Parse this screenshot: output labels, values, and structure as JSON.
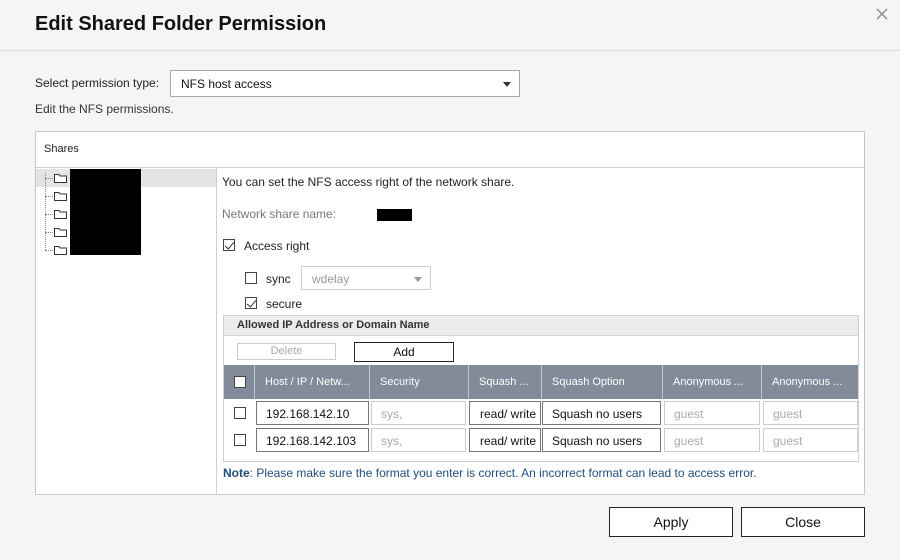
{
  "dialog": {
    "title": "Edit Shared Folder Permission",
    "close_icon": "close-icon"
  },
  "permission": {
    "label": "Select permission type:",
    "selected": "NFS host access",
    "description": "Edit the NFS permissions."
  },
  "shares": {
    "header": "Shares",
    "folder_icon": "folder-icon",
    "item_count": 5
  },
  "nfs": {
    "intro": "You can set the NFS access right of the network share.",
    "share_name_label": "Network share name:",
    "access_right_label": "Access right",
    "access_right_checked": true,
    "sync_label": "sync",
    "sync_checked": false,
    "sync_option": "wdelay",
    "secure_label": "secure",
    "secure_checked": true
  },
  "allowed": {
    "header": "Allowed IP Address or Domain Name",
    "delete_label": "Delete",
    "add_label": "Add",
    "columns": [
      "Host / IP / Netw...",
      "Security",
      "Squash ...",
      "Squash Option",
      "Anonymous ...",
      "Anonymous ..."
    ],
    "rows": [
      {
        "host": "192.168.142.10",
        "security": "sys,",
        "squash": "read/ write",
        "squash_option": "Squash no users",
        "anon_uid": "guest",
        "anon_gid": "guest"
      },
      {
        "host": "192.168.142.103",
        "security": "sys,",
        "squash": "read/ write",
        "squash_option": "Squash no users",
        "anon_uid": "guest",
        "anon_gid": "guest"
      }
    ],
    "note_prefix": "Note",
    "note_text": ": Please make sure the format you enter is correct. An incorrect format can lead to access error."
  },
  "buttons": {
    "apply": "Apply",
    "close": "Close"
  },
  "colors": {
    "grid_header": "#818b99",
    "note_text": "#1f4e7a"
  }
}
